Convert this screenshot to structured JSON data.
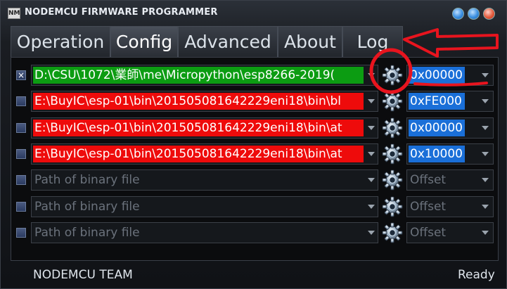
{
  "window": {
    "title": "NODEMCU FIRMWARE PROGRAMMER",
    "icon_label": "NM"
  },
  "tabs": [
    {
      "label": "Operation",
      "active": false
    },
    {
      "label": "Config",
      "active": true
    },
    {
      "label": "Advanced",
      "active": false
    },
    {
      "label": "About",
      "active": false
    },
    {
      "label": "Log",
      "active": false
    }
  ],
  "rows": [
    {
      "checked": true,
      "path": "D:\\CSU\\1072\\業師\\me\\Micropython\\esp8266-2019(",
      "path_state": "green",
      "offset": "0x00000"
    },
    {
      "checked": false,
      "path": "E:\\BuyIC\\esp-01\\bin\\201505081642229eni18\\bin\\bl",
      "path_state": "red",
      "offset": "0xFE000"
    },
    {
      "checked": false,
      "path": "E:\\BuyIC\\esp-01\\bin\\201505081642229eni18\\bin\\at",
      "path_state": "red",
      "offset": "0x00000"
    },
    {
      "checked": false,
      "path": "E:\\BuyIC\\esp-01\\bin\\201505081642229eni18\\bin\\at",
      "path_state": "red",
      "offset": "0x10000"
    },
    {
      "checked": false,
      "path_placeholder": "Path of binary file",
      "offset_placeholder": "Offset"
    },
    {
      "checked": false,
      "path_placeholder": "Path of binary file",
      "offset_placeholder": "Offset"
    },
    {
      "checked": false,
      "path_placeholder": "Path of binary file",
      "offset_placeholder": "Offset"
    }
  ],
  "status": {
    "left": "NODEMCU TEAM",
    "right": "Ready"
  },
  "colors": {
    "accent_blue": "#1a6fd8",
    "path_ok": "#0c9c12",
    "path_error": "#ee0b0b",
    "annotation": "#e8141e"
  },
  "icons": [
    "gear-icon",
    "checkbox-checked-icon",
    "chevron-down-icon"
  ]
}
